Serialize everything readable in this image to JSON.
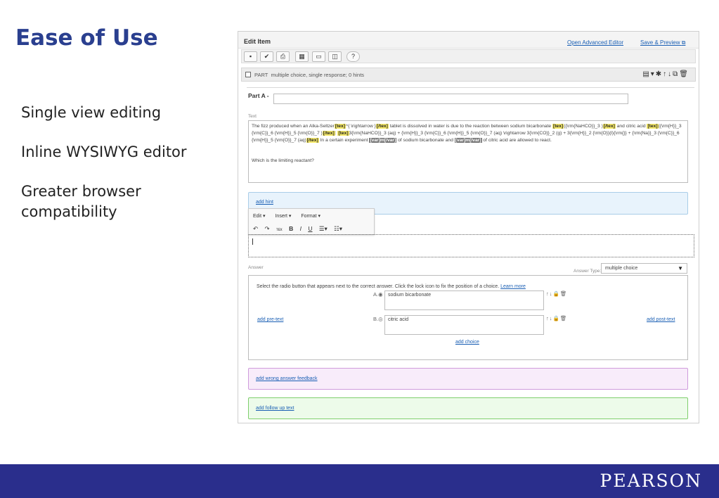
{
  "slide": {
    "title": "Ease of Use",
    "bullets": [
      "Single view editing",
      "Inline WYSIWYG editor",
      "Greater browser compatibility"
    ],
    "brand": "PEARSON",
    "colors": {
      "title": "#2a3f8f",
      "footer": "#2a2e8c"
    }
  },
  "editor": {
    "title": "Edit Item",
    "open_advanced": "Open Advanced Editor",
    "save_preview": "Save & Preview",
    "toolbar_icons": [
      "save-icon",
      "check-icon",
      "print-icon",
      "grid-icon",
      "image-icon",
      "columns-icon",
      "help-icon"
    ],
    "toolbar_glyphs": [
      "▪",
      "✔",
      "⎙",
      "▦",
      "▭",
      "◫",
      "?"
    ],
    "part": {
      "label": "PART",
      "summary": "multiple choice, single response; 0 hints",
      "icons": "▤▾✱↑↓⧉🗑",
      "part_a": "Part A -"
    },
    "text_caption": "Text",
    "text": {
      "p1": "The fizz produced when an Alka-Seltzer",
      "tex1": "[tex]",
      "p2": "^{ \\rightarrow }",
      "tex2": "[/tex]",
      "p3": " tablet is dissolved in water is due to the reaction between sodium bicarbonate ",
      "tex3": "[tex]",
      "p4": "({\\rm{NaHCO}}_3 )",
      "tex4": "[/tex]",
      "p5": " and citric acid ",
      "tex5": "[tex]",
      "p6": "({\\rm{H}}_3 {\\rm{C}}_6 {\\rm{H}}_5 {\\rm{O}}_7 )",
      "tex6": "[/tex]",
      "p7": ": ",
      "tex7": "[tex]",
      "p8": "3{\\rm{NaHCO}}_3 (aq) + {\\rm{H}}_3 {\\rm{C}}_6 {\\rm{H}}_5 {\\rm{O}}_7 (aq) \\rightarrow 3{\\rm{CO}}_2 (g) + 3{\\rm{H}}_2 {\\rm{O}}(l){\\rm{}} + {\\rm{Na}}_3 {\\rm{C}}_6 {\\rm{H}}_5 {\\rm{O}}_7 (aq)",
      "tex8": "[/tex]",
      "p9": " In a certain experiment ",
      "var1": "[var]m[/var]",
      "p10": " of sodium bicarbonate and ",
      "var2": "[var]m[/var]",
      "p11": " of citric acid are allowed to react.",
      "question": "Which is the limiting reactant?"
    },
    "add_hint": "add hint",
    "menu": {
      "edit": "Edit ▾",
      "insert": "Insert ▾",
      "format": "Format ▾",
      "tools": [
        "↶",
        "↷",
        "ᴛᴇx",
        "B",
        "I",
        "U",
        "☰▾",
        "☷▾"
      ]
    },
    "answer_caption": "Answer",
    "answer_type_label": "Answer Type:",
    "answer_type": "multiple choice",
    "instruction": "Select the radio button that appears next to the correct answer. Click the lock icon to fix the position of a choice.",
    "learn_more": "Learn more",
    "choices": [
      {
        "letter": "A.◉",
        "text": "sodium bicarbonate",
        "icons": "↑↓🔒🗑"
      },
      {
        "letter": "B.◎",
        "text": "citric acid",
        "icons": "↑↓🔒🗑"
      }
    ],
    "add_pre_text": "add pre-text",
    "add_post_text": "add post-text",
    "add_choice": "add choice",
    "add_wrong_feedback": "add wrong answer feedback",
    "add_follow_up": "add follow up text"
  }
}
